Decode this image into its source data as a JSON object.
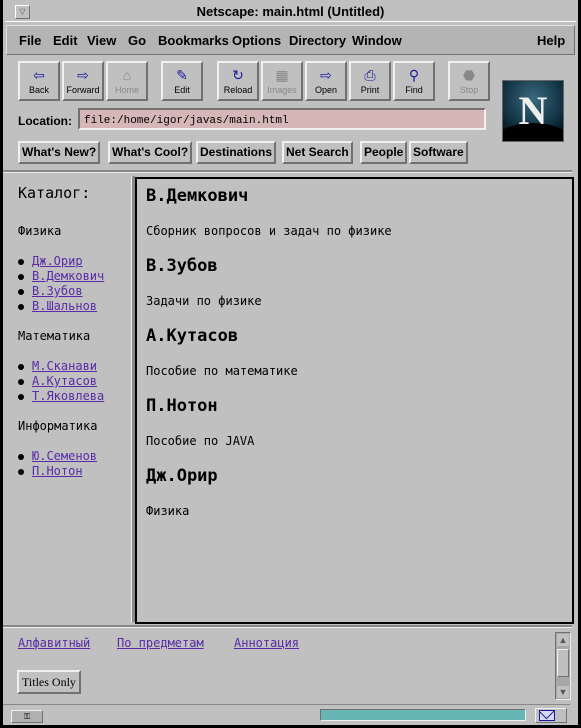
{
  "window": {
    "title": "Netscape: main.html (Untitled)"
  },
  "menu": [
    "File",
    "Edit",
    "View",
    "Go",
    "Bookmarks",
    "Options",
    "Directory",
    "Window",
    "Help"
  ],
  "toolbar": {
    "back": {
      "label": "Back",
      "icon": "⇦"
    },
    "forward": {
      "label": "Forward",
      "icon": "⇨"
    },
    "home": {
      "label": "Home",
      "icon": "⌂"
    },
    "edit": {
      "label": "Edit",
      "icon": "✎"
    },
    "reload": {
      "label": "Reload",
      "icon": "↻"
    },
    "images": {
      "label": "Images",
      "icon": "▦"
    },
    "open": {
      "label": "Open",
      "icon": "⇨"
    },
    "print": {
      "label": "Print",
      "icon": "⎙"
    },
    "find": {
      "label": "Find",
      "icon": "⚲"
    },
    "stop": {
      "label": "Stop",
      "icon": "⬣"
    }
  },
  "logo": {
    "letter": "N"
  },
  "location": {
    "label": "Location:",
    "value": "file:/home/igor/javas/main.html"
  },
  "directory_buttons": [
    "What's New?",
    "What's Cool?",
    "Destinations",
    "Net Search",
    "People",
    "Software"
  ],
  "catalog": {
    "title": "Каталог:",
    "sections": [
      {
        "name": "Физика",
        "links": [
          "Дж.Орир",
          "В.Демкович",
          "В.Зубов",
          "В.Шальнов"
        ]
      },
      {
        "name": "Математика",
        "links": [
          "М.Сканави",
          "А.Кутасов",
          "Т.Яковлева"
        ]
      },
      {
        "name": "Информатика",
        "links": [
          "Ю.Семенов",
          "П.Нотон"
        ]
      }
    ]
  },
  "main": {
    "entries": [
      {
        "author": "В.Демкович",
        "title": "Сборник вопросов и задач по физике"
      },
      {
        "author": "В.Зубов",
        "title": "Задачи по физике"
      },
      {
        "author": "А.Кутасов",
        "title": "Пособие по математике"
      },
      {
        "author": "П.Нотон",
        "title": "Пособие по JAVA"
      },
      {
        "author": "Дж.Орир",
        "title": "Физика"
      }
    ]
  },
  "bottom": {
    "links": [
      "Алфавитный",
      "По предметам",
      "Аннотация"
    ],
    "titles_button": "Titles Only"
  },
  "status": {
    "security_icon": "key-icon",
    "progress_percent": 100,
    "mail_icon": "mail-icon"
  },
  "colors": {
    "link": "#5a2aa8",
    "location_bg": "#d7b6b8",
    "progress": "#66b6b6"
  }
}
